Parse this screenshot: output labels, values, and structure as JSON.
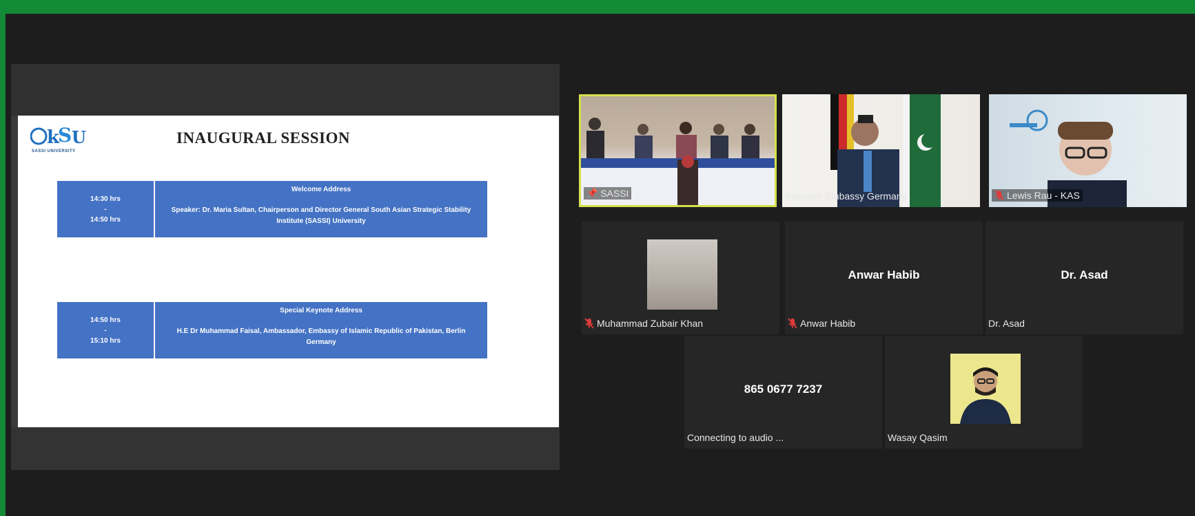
{
  "colors": {
    "frame_green": "#138a36",
    "background": "#1d1d1d",
    "active_speaker_border": "#d6e04a",
    "agenda_blue": "#4472c4"
  },
  "shared_screen": {
    "logo_text": "SASSI",
    "logo_subtext": "SASSI UNIVERSITY",
    "title": "INAUGURAL SESSION",
    "agenda": [
      {
        "time_start": "14:30 hrs",
        "time_sep": "-",
        "time_end": "14:50 hrs",
        "heading": "Welcome Address",
        "detail": "Speaker: Dr. Maria Sultan, Chairperson and Director General South Asian Strategic Stability Institute (SASSI) University"
      },
      {
        "time_start": "14:50 hrs",
        "time_sep": "-",
        "time_end": "15:10 hrs",
        "heading": "Special Keynote Address",
        "detail": "H.E Dr Muhammad Faisal, Ambassador, Embassy of Islamic Republic of Pakistan, Berlin Germany"
      }
    ]
  },
  "participants": [
    {
      "label": "SASSI",
      "icon": "pin-icon",
      "muted": false,
      "center_label": ""
    },
    {
      "label": "Pakistan Embassy Germany",
      "icon": "",
      "muted": false,
      "center_label": ""
    },
    {
      "label": "Lewis Rau - KAS",
      "icon": "mic-muted-icon",
      "muted": true,
      "center_label": ""
    },
    {
      "label": "Muhammad Zubair Khan",
      "icon": "mic-muted-icon",
      "muted": true,
      "center_label": ""
    },
    {
      "label": "Anwar Habib",
      "icon": "mic-muted-icon",
      "muted": true,
      "center_label": "Anwar Habib"
    },
    {
      "label": "Dr. Asad",
      "icon": "",
      "muted": false,
      "center_label": "Dr. Asad"
    },
    {
      "label": "Connecting to audio ...",
      "icon": "",
      "muted": false,
      "center_label": "865 0677 7237"
    },
    {
      "label": "Wasay Qasim",
      "icon": "",
      "muted": false,
      "center_label": ""
    }
  ]
}
